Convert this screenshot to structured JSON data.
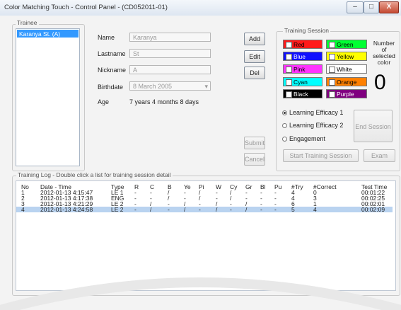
{
  "window": {
    "title": "Color Matching Touch - Control Panel - (CD052011-01)",
    "min_glyph": "–",
    "max_glyph": "□",
    "close_glyph": "X"
  },
  "trainee": {
    "group_label": "Trainee",
    "list": [
      "Karanya St. (A)"
    ]
  },
  "form": {
    "name_label": "Name",
    "name_value": "Karanya",
    "lastname_label": "Lastname",
    "lastname_value": "St",
    "nickname_label": "Nickname",
    "nickname_value": "A",
    "birthdate_label": "Birthdate",
    "birthdate_value": "8  March  2005",
    "age_label": "Age",
    "age_value": "7 years 4 months 8 days"
  },
  "buttons": {
    "add": "Add",
    "edit": "Edit",
    "del": "Del",
    "submit": "Submit",
    "cancel": "Cancel",
    "end_session": "End Session",
    "start_training": "Start Training Session",
    "exam": "Exam"
  },
  "training_session": {
    "group_label": "Training Session",
    "colors": [
      {
        "label": "Red",
        "bg": "#ff1a1a",
        "fg": "#000000"
      },
      {
        "label": "Green",
        "bg": "#00ff33",
        "fg": "#000000"
      },
      {
        "label": "Blue",
        "bg": "#1010ff",
        "fg": "#ffffff"
      },
      {
        "label": "Yellow",
        "bg": "#ffff00",
        "fg": "#000000"
      },
      {
        "label": "Pink",
        "bg": "#ff33ff",
        "fg": "#000000"
      },
      {
        "label": "White",
        "bg": "#ffffff",
        "fg": "#000000"
      },
      {
        "label": "Cyan",
        "bg": "#00ffff",
        "fg": "#000000"
      },
      {
        "label": "Orange",
        "bg": "#ff8000",
        "fg": "#000000"
      },
      {
        "label": "Black",
        "bg": "#000000",
        "fg": "#ffffff"
      },
      {
        "label": "Purple",
        "bg": "#800080",
        "fg": "#ffffff"
      }
    ],
    "number_label_line1": "Number",
    "number_label_line2": "of",
    "number_label_line3": "selected",
    "number_label_line4": "color",
    "number_value": "0",
    "modes": [
      "Learning Efficacy 1",
      "Learning Efficacy 2",
      "Engagement"
    ],
    "selected_mode": 0
  },
  "log": {
    "group_label": "Training Log - Double click a list for training session detail",
    "columns": [
      "No",
      "Date - Time",
      "Type",
      "R",
      "C",
      "B",
      "Ye",
      "Pi",
      "W",
      "Cy",
      "Gr",
      "Bl",
      "Pu",
      "#Try",
      "#Correct",
      "Test Time"
    ],
    "rows": [
      [
        "1",
        "2012-01-13  4:15:47",
        "LE 1",
        "-",
        "-",
        "/",
        "-",
        "/",
        "-",
        "/",
        "-",
        "-",
        "-",
        "4",
        "0",
        "00:01:22"
      ],
      [
        "2",
        "2012-01-13  4:17:38",
        "ENG",
        "-",
        "-",
        "/",
        "-",
        "/",
        "-",
        "/",
        "-",
        "-",
        "-",
        "4",
        "3",
        "00:02:25"
      ],
      [
        "3",
        "2012-01-13  4:21:29",
        "LE 2",
        "-",
        "/",
        "-",
        "/",
        "-",
        "/",
        "-",
        "/",
        "-",
        "-",
        "6",
        "1",
        "00:02:01"
      ],
      [
        "4",
        "2012-01-13  4:24:58",
        "LE 2",
        "-",
        "/",
        "-",
        "/",
        "-",
        "/",
        "-",
        "/",
        "-",
        "-",
        "5",
        "4",
        "00:02:09"
      ]
    ],
    "selected_row": 3
  }
}
